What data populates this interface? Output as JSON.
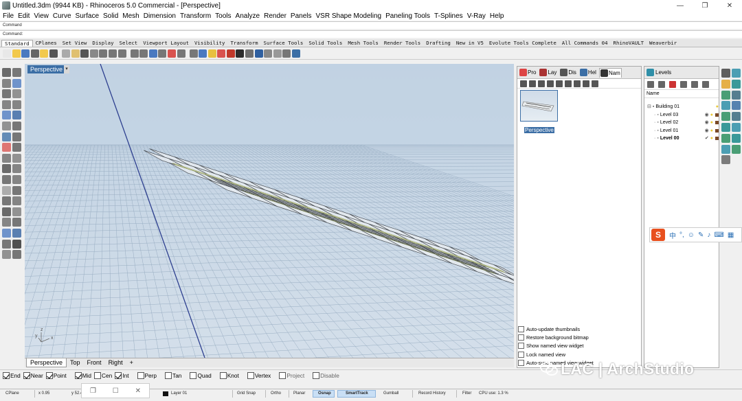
{
  "window": {
    "title": "Untitled.3dm (9944 KB) - Rhinoceros 5.0 Commercial - [Perspective]",
    "minimize": "—",
    "maximize": "❐",
    "close": "✕"
  },
  "menu": [
    "File",
    "Edit",
    "View",
    "Curve",
    "Surface",
    "Solid",
    "Mesh",
    "Dimension",
    "Transform",
    "Tools",
    "Analyze",
    "Render",
    "Panels",
    "VSR Shape Modeling",
    "Paneling Tools",
    "T-Splines",
    "V-Ray",
    "Help"
  ],
  "command": {
    "line1": "Command",
    "line2": "Command:"
  },
  "toolbar_tabs": [
    "Standard",
    "CPlanes",
    "Set View",
    "Display",
    "Select",
    "Viewport Layout",
    "Visibility",
    "Transform",
    "Surface Tools",
    "Solid Tools",
    "Mesh Tools",
    "Render Tools",
    "Drafting",
    "New in V5",
    "Evolute Tools Complete",
    "All Commands 04",
    "RhinoVAULT",
    "Weaverbir"
  ],
  "toolbar_icons": [
    "new-icon",
    "open-icon",
    "save-icon",
    "print-icon",
    "import-icon",
    "cut-icon",
    "copy-icon",
    "paste-icon",
    "undo-icon",
    "pan-icon",
    "rotate-view-icon",
    "zoom-dynamic-icon",
    "zoom-window-icon",
    "zoom-extents-icon",
    "zoom-selected-icon",
    "four-viewports-icon",
    "cplane-icon",
    "surface-icon",
    "point-icon",
    "curve-icon",
    "sphere-icon",
    "light-icon",
    "material-icon",
    "object-properties-icon",
    "render-icon",
    "shaded-icon",
    "rendered-icon",
    "ghosted-icon",
    "xray-icon",
    "display-options-icon",
    "help-icon"
  ],
  "viewport": {
    "label": "Perspective",
    "axis_x": "x",
    "axis_y": "y",
    "axis_z": "z"
  },
  "view_tabs": [
    "Perspective",
    "Top",
    "Front",
    "Right",
    "+"
  ],
  "named_views_panel": {
    "tabs": [
      "Pro",
      "Lay",
      "Dis",
      "Hel",
      "Nam"
    ],
    "thumbnail_label": "Perspective",
    "options": [
      "Auto-update thumbnails",
      "Restore background bitmap",
      "Show named view widget",
      "Lock named view",
      "Auto-sync named view widget"
    ]
  },
  "layers_panel": {
    "tab": "Levels",
    "header": "Name",
    "rows": [
      {
        "name": "Building 01",
        "color": "#c8a020"
      },
      {
        "name": "Level 03",
        "color": "#7a4a28"
      },
      {
        "name": "Level 02",
        "color": "#7a4a28"
      },
      {
        "name": "Level 01",
        "color": "#7a4a28"
      },
      {
        "name": "Level 00",
        "color": "#7a4a28"
      }
    ]
  },
  "ime": {
    "logo": "S",
    "lang": "中"
  },
  "osnap": [
    {
      "label": "End",
      "checked": true
    },
    {
      "label": "Near",
      "checked": true
    },
    {
      "label": "Point",
      "checked": true
    },
    {
      "label": "Mid",
      "checked": true
    },
    {
      "label": "Cen",
      "checked": false
    },
    {
      "label": "Int",
      "checked": true
    },
    {
      "label": "Perp",
      "checked": false
    },
    {
      "label": "Tan",
      "checked": false
    },
    {
      "label": "Quad",
      "checked": false
    },
    {
      "label": "Knot",
      "checked": false
    },
    {
      "label": "Vertex",
      "checked": false
    },
    {
      "label": "Project",
      "checked": false,
      "dim": true
    },
    {
      "label": "Disable",
      "checked": false,
      "dim": true
    }
  ],
  "status": {
    "cplane": "CPlane",
    "x": "x 0.95",
    "y": "y 52.4",
    "layer": "Layer 01",
    "grid_snap": "Grid Snap",
    "ortho": "Ortho",
    "planar": "Planar",
    "osnap": "Osnap",
    "smarttrack": "SmartTrack",
    "gumball": "Gumball",
    "record_history": "Record History",
    "filter": "Filter",
    "cpu": "CPU use: 1.3 %"
  },
  "watermark": "LAC | ArchStudio",
  "colors": {
    "accent": "#3b6ea5",
    "viewport_bg": "#c7d6e5",
    "grid": "#98adc2"
  }
}
